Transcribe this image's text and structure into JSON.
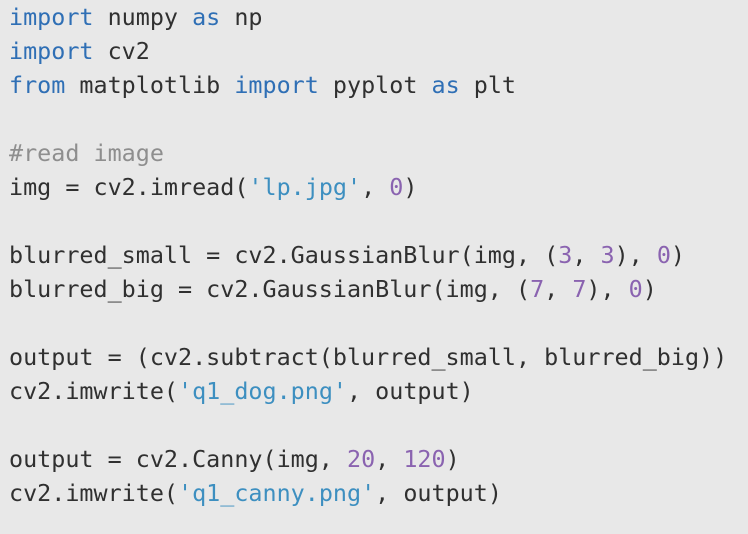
{
  "editor": {
    "lines": [
      [
        {
          "t": "import",
          "k": "keyword"
        },
        {
          "t": " numpy ",
          "k": "plain"
        },
        {
          "t": "as",
          "k": "keyword"
        },
        {
          "t": " np",
          "k": "plain"
        }
      ],
      [
        {
          "t": "import",
          "k": "keyword"
        },
        {
          "t": " cv2",
          "k": "plain"
        }
      ],
      [
        {
          "t": "from",
          "k": "keyword"
        },
        {
          "t": " matplotlib ",
          "k": "plain"
        },
        {
          "t": "import",
          "k": "keyword"
        },
        {
          "t": " pyplot ",
          "k": "plain"
        },
        {
          "t": "as",
          "k": "keyword"
        },
        {
          "t": " plt",
          "k": "plain"
        }
      ],
      [],
      [
        {
          "t": "#read image",
          "k": "comment"
        }
      ],
      [
        {
          "t": "img = cv2.imread(",
          "k": "plain"
        },
        {
          "t": "'lp.jpg'",
          "k": "string"
        },
        {
          "t": ", ",
          "k": "plain"
        },
        {
          "t": "0",
          "k": "number"
        },
        {
          "t": ")",
          "k": "plain"
        }
      ],
      [],
      [
        {
          "t": "blurred_small = cv2.GaussianBlur(img, (",
          "k": "plain"
        },
        {
          "t": "3",
          "k": "number"
        },
        {
          "t": ", ",
          "k": "plain"
        },
        {
          "t": "3",
          "k": "number"
        },
        {
          "t": "), ",
          "k": "plain"
        },
        {
          "t": "0",
          "k": "number"
        },
        {
          "t": ")",
          "k": "plain"
        }
      ],
      [
        {
          "t": "blurred_big = cv2.GaussianBlur(img, (",
          "k": "plain"
        },
        {
          "t": "7",
          "k": "number"
        },
        {
          "t": ", ",
          "k": "plain"
        },
        {
          "t": "7",
          "k": "number"
        },
        {
          "t": "), ",
          "k": "plain"
        },
        {
          "t": "0",
          "k": "number"
        },
        {
          "t": ")",
          "k": "plain"
        }
      ],
      [],
      [
        {
          "t": "output = (cv2.subtract(blurred_small, blurred_big))",
          "k": "plain"
        }
      ],
      [
        {
          "t": "cv2.imwrite(",
          "k": "plain"
        },
        {
          "t": "'q1_dog.png'",
          "k": "string"
        },
        {
          "t": ", output)",
          "k": "plain"
        }
      ],
      [],
      [
        {
          "t": "output = cv2.Canny(img, ",
          "k": "plain"
        },
        {
          "t": "20",
          "k": "number"
        },
        {
          "t": ", ",
          "k": "plain"
        },
        {
          "t": "120",
          "k": "number"
        },
        {
          "t": ")",
          "k": "plain"
        }
      ],
      [
        {
          "t": "cv2.imwrite(",
          "k": "plain"
        },
        {
          "t": "'q1_canny.png'",
          "k": "string"
        },
        {
          "t": ", output)",
          "k": "plain"
        }
      ]
    ]
  },
  "colors": {
    "background": "#e8e8e8",
    "keyword": "#2f6fb5",
    "string": "#3d8fc0",
    "number": "#8a63b0",
    "comment": "#8e8e8e",
    "text": "#303030"
  }
}
